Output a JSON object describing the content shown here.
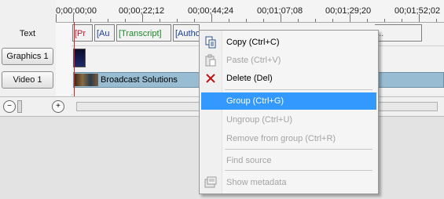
{
  "timeline": {
    "ruler_labels": [
      "0;00;00;00",
      "00;00;22;12",
      "00;00;44;24",
      "00;01;07;08",
      "00;01;29;20",
      "00;01;52;02"
    ],
    "tracks": {
      "text": {
        "label": "Text",
        "clips": [
          "[Pr",
          "[Au",
          "[Transcript]",
          "[Autho"
        ],
        "trailing_text": "..."
      },
      "graphics": {
        "label": "Graphics 1"
      },
      "video": {
        "label": "Video 1",
        "clip_title": "Broadcast Solutions"
      }
    },
    "colors": {
      "clip_red": "#c0162c",
      "clip_blue": "#1a3d9c",
      "clip_green": "#1a8a2a",
      "video_clip": "#98bcd1",
      "playhead": "#d32020"
    }
  },
  "context_menu": {
    "items": [
      {
        "label": "Copy (Ctrl+C)",
        "enabled": true,
        "icon": "copy-icon"
      },
      {
        "label": "Paste (Ctrl+V)",
        "enabled": false,
        "icon": "paste-icon"
      },
      {
        "label": "Delete (Del)",
        "enabled": true,
        "icon": "delete-icon"
      },
      {
        "label": "Group (Ctrl+G)",
        "enabled": true,
        "highlighted": true
      },
      {
        "label": "Ungroup (Ctrl+U)",
        "enabled": false
      },
      {
        "label": "Remove from group (Ctrl+R)",
        "enabled": false
      },
      {
        "label": "Find source",
        "enabled": false
      },
      {
        "label": "Show metadata",
        "enabled": false,
        "icon": "metadata-icon"
      }
    ],
    "highlight_color": "#3399ff"
  }
}
